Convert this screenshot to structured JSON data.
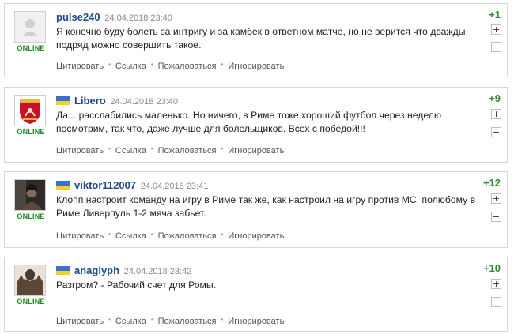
{
  "comments": [
    {
      "username": "pulse240",
      "date": "24.04.2018 23:40",
      "text": "Я конечно буду болеть за интригу и за камбек в ответном матче, но не верится что дважды подряд можно совершить такое.",
      "score": "+1",
      "status": "ONLINE",
      "has_flag": false,
      "avatar": "default-user-avatar"
    },
    {
      "username": "Libero",
      "date": "24.04.2018 23:40",
      "text": "Да... расслабились маленько. Но ничего, в Риме тоже хороший футбол через неделю посмотрим, так что, даже лучше для болельщиков. Всех с победой!!!",
      "score": "+9",
      "status": "ONLINE",
      "has_flag": true,
      "avatar": "liverpool-crest-avatar"
    },
    {
      "username": "viktor112007",
      "date": "24.04.2018 23:41",
      "text": "Клопп настроит команду на игру в Риме так же, как настроил на игру против МС. полюбому в Риме Ливерпуль 1-2 мяча забьет.",
      "score": "+12",
      "status": "ONLINE",
      "has_flag": true,
      "avatar": "person-photo-avatar"
    },
    {
      "username": "anaglyph",
      "date": "24.04.2018 23:42",
      "text": "Разгром? - Рабочий счет для Ромы.",
      "score": "+10",
      "status": "ONLINE",
      "has_flag": true,
      "avatar": "person-photo-avatar"
    }
  ],
  "actions": {
    "quote": "Цитировать",
    "link": "Ссылка",
    "report": "Пожаловаться",
    "ignore": "Игнорировать"
  },
  "vote": {
    "plus": "+",
    "minus": "−"
  },
  "colors": {
    "username": "#1e4a8c",
    "score": "#2e8b2e",
    "online": "#1f8a1f",
    "flag_blue": "#3b6fd0",
    "flag_yellow": "#f2d21e"
  }
}
